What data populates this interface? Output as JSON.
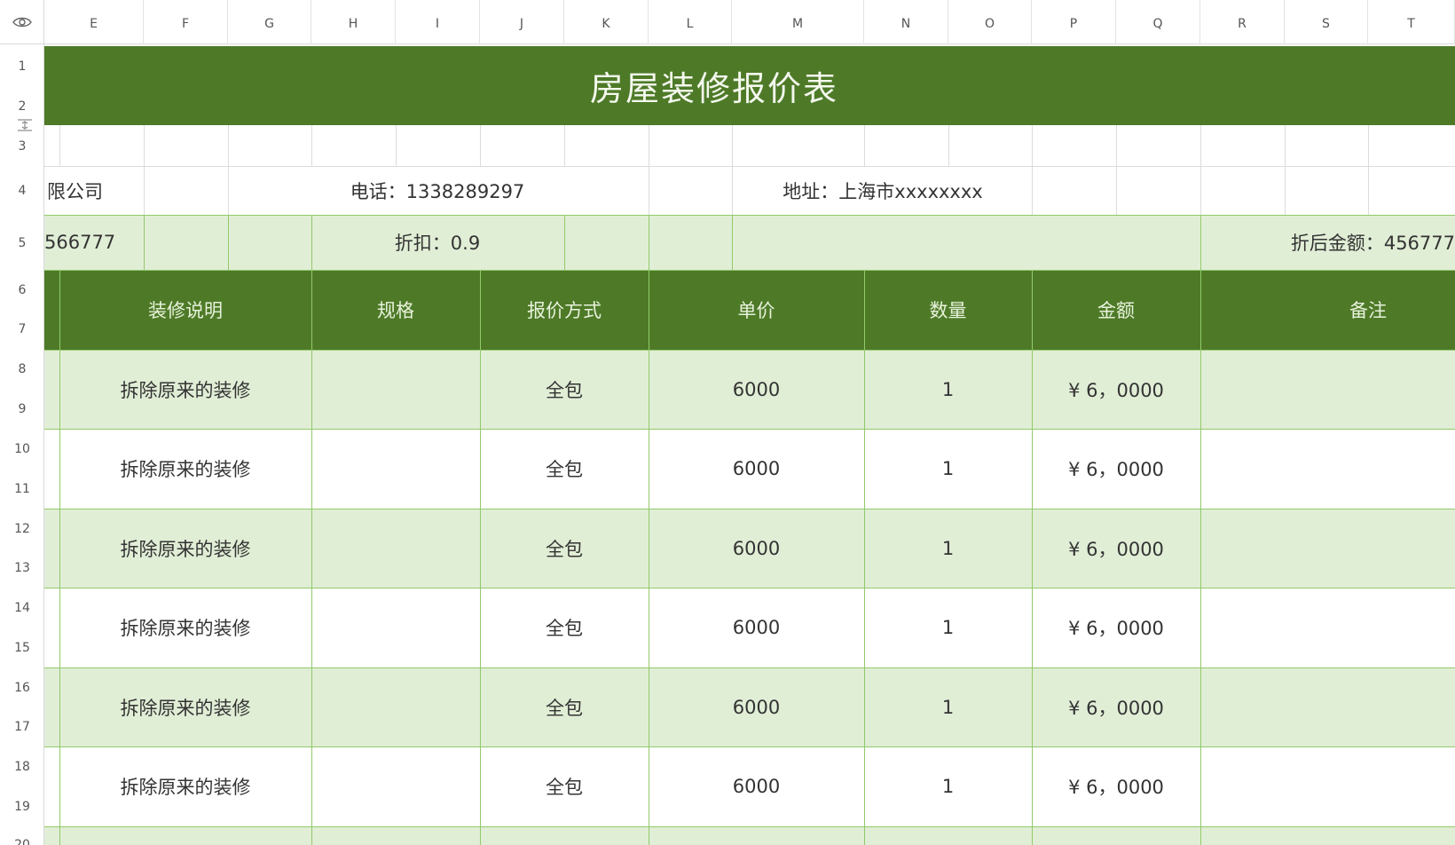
{
  "columns": [
    "E",
    "F",
    "G",
    "H",
    "I",
    "J",
    "K",
    "L",
    "M",
    "N",
    "O",
    "P",
    "Q",
    "R",
    "S",
    "T"
  ],
  "rows": [
    "1",
    "2",
    "3",
    "4",
    "5",
    "6",
    "7",
    "8",
    "9",
    "10",
    "11",
    "12",
    "13",
    "14",
    "15",
    "16",
    "17",
    "18",
    "19",
    "20"
  ],
  "title": "房屋装修报价表",
  "info": {
    "company": "限公司",
    "phone": "电话：1338289297",
    "address": "地址：上海市xxxxxxxx",
    "total_partial": "566777",
    "discount": "折扣：0.9",
    "discounted_total": "折后金额：456777"
  },
  "table": {
    "headers": [
      "装修说明",
      "规格",
      "报价方式",
      "单价",
      "数量",
      "金额",
      "备注"
    ],
    "rows": [
      {
        "desc": "拆除原来的装修",
        "spec": "",
        "method": "全包",
        "price": "6000",
        "qty": "1",
        "amount": "¥ 6，0000",
        "note": ""
      },
      {
        "desc": "拆除原来的装修",
        "spec": "",
        "method": "全包",
        "price": "6000",
        "qty": "1",
        "amount": "¥ 6，0000",
        "note": ""
      },
      {
        "desc": "拆除原来的装修",
        "spec": "",
        "method": "全包",
        "price": "6000",
        "qty": "1",
        "amount": "¥ 6，0000",
        "note": ""
      },
      {
        "desc": "拆除原来的装修",
        "spec": "",
        "method": "全包",
        "price": "6000",
        "qty": "1",
        "amount": "¥ 6，0000",
        "note": ""
      },
      {
        "desc": "拆除原来的装修",
        "spec": "",
        "method": "全包",
        "price": "6000",
        "qty": "1",
        "amount": "¥ 6，0000",
        "note": ""
      },
      {
        "desc": "拆除原来的装修",
        "spec": "",
        "method": "全包",
        "price": "6000",
        "qty": "1",
        "amount": "¥ 6，0000",
        "note": ""
      }
    ]
  },
  "icons": {
    "corner": "eye-icon",
    "resize": "row-resize-icon"
  },
  "colors": {
    "header_green": "#4e7a28",
    "light_green": "#e1eed6",
    "grid_green": "#92c96a"
  }
}
